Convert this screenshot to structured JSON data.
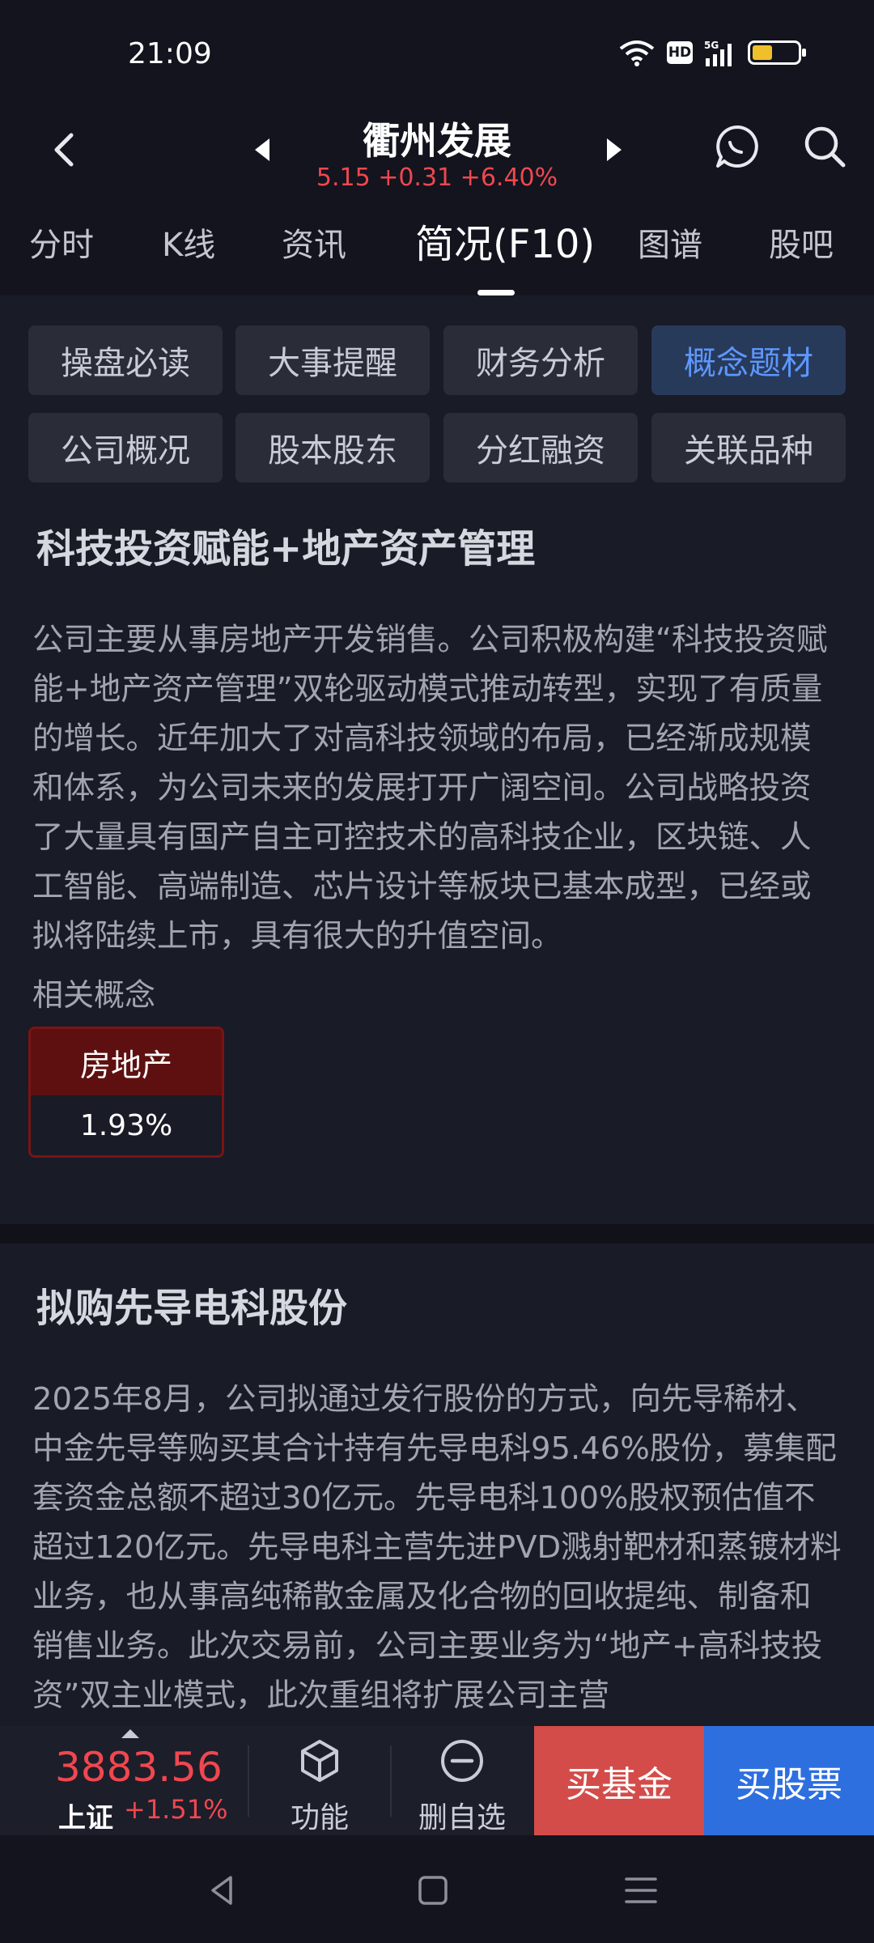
{
  "status_bar": {
    "time": "21:09",
    "network": "5G",
    "hd_label": "HD",
    "battery_level": 0.45
  },
  "header": {
    "stock_name": "衢州发展",
    "quote": "5.15 +0.31 +6.40%",
    "price_color": "#f0474f"
  },
  "tabs": [
    {
      "label": "分时",
      "active": false
    },
    {
      "label": "K线",
      "active": false
    },
    {
      "label": "资讯",
      "active": false
    },
    {
      "label": "简况(F10)",
      "active": true
    },
    {
      "label": "图谱",
      "active": false
    },
    {
      "label": "股吧",
      "active": false
    }
  ],
  "section_buttons": [
    {
      "label": "操盘必读",
      "selected": false
    },
    {
      "label": "大事提醒",
      "selected": false
    },
    {
      "label": "财务分析",
      "selected": false
    },
    {
      "label": "概念题材",
      "selected": true
    },
    {
      "label": "公司概况",
      "selected": false
    },
    {
      "label": "股本股东",
      "selected": false
    },
    {
      "label": "分红融资",
      "selected": false
    },
    {
      "label": "关联品种",
      "selected": false
    }
  ],
  "section1": {
    "title": "科技投资赋能+地产资产管理",
    "body": "公司主要从事房地产开发销售。公司积极构建“科技投资赋能+地产资产管理”双轮驱动模式推动转型，实现了有质量的增长。近年加大了对高科技领域的布局，已经渐成规模和体系，为公司未来的发展打开广阔空间。公司战略投资了大量具有国产自主可控技术的高科技企业，区块链、人工智能、高端制造、芯片设计等板块已基本成型，已经或拟将陆续上市，具有很大的升值空间。",
    "related_label": "相关概念",
    "concept": {
      "name": "房地产",
      "value": "1.93%"
    }
  },
  "section2": {
    "title": "拟购先导电科股份",
    "body": "2025年8月，公司拟通过发行股份的方式，向先导稀材、中金先导等购买其合计持有先导电科95.46%股份，募集配套资金总额不超过30亿元。先导电科100%股权预估值不超过120亿元。先导电科主营先进PVD溅射靶材和蒸镀材料业务，也从事高纯稀散金属及化合物的回收提纯、制备和销售业务。此次交易前，公司主要业务为“地产+高科技投资”双主业模式，此次重组将扩展公司主营"
  },
  "bottom_bar": {
    "index_value": "3883.56",
    "index_name": "上证",
    "index_change": "+1.51%",
    "function_label": "功能",
    "remove_watch_label": "删自选",
    "buy_fund_label": "买基金",
    "buy_stock_label": "买股票"
  }
}
